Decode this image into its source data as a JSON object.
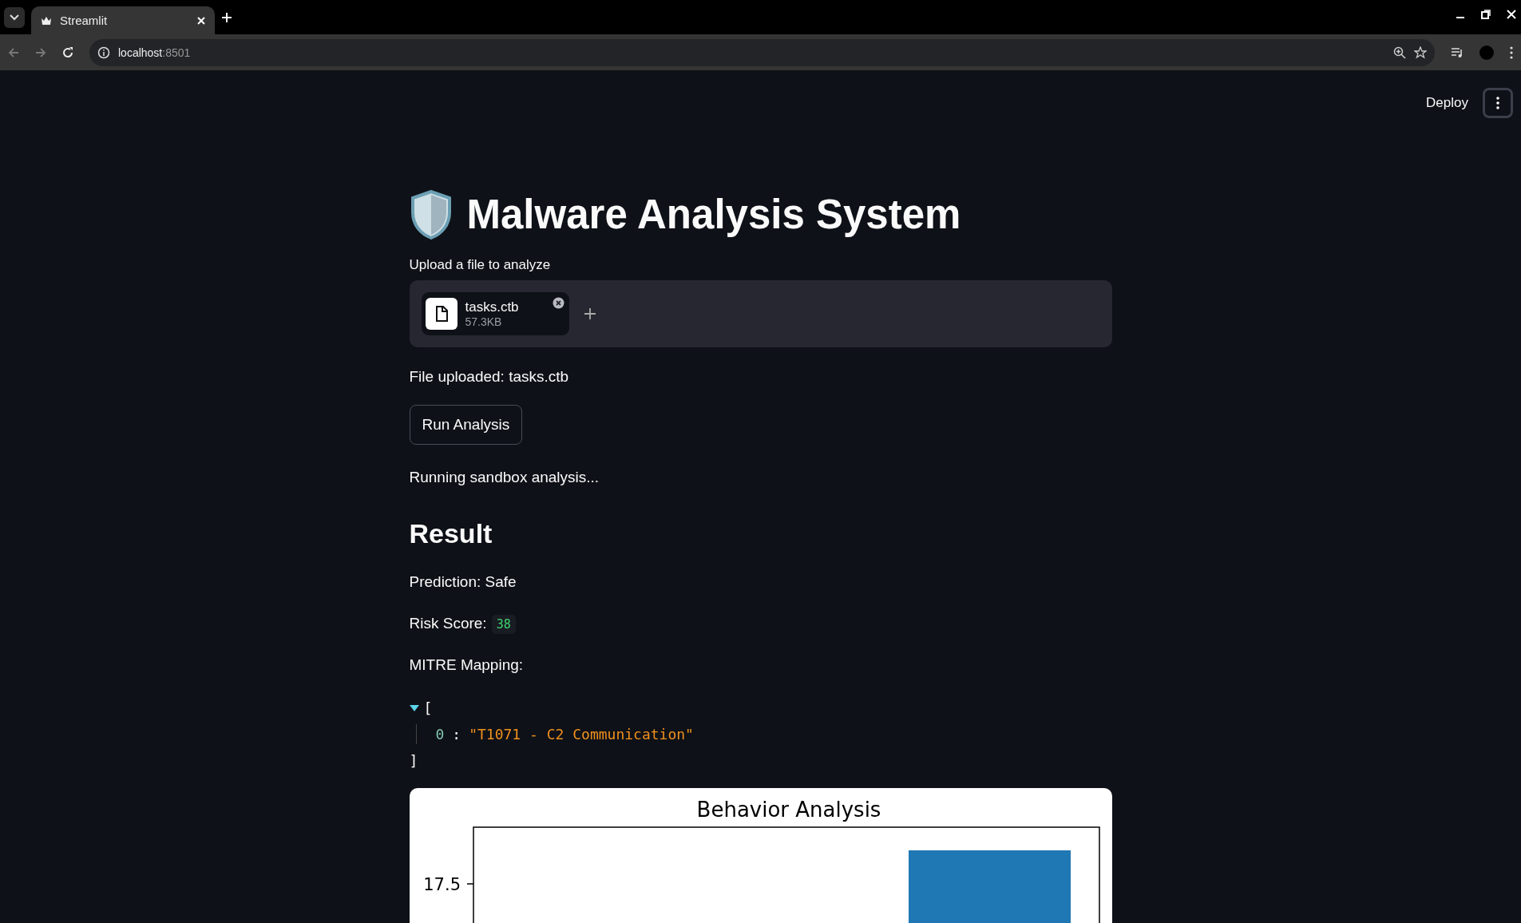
{
  "browser": {
    "tab_title": "Streamlit",
    "url_host": "localhost",
    "url_port": ":8501"
  },
  "header": {
    "deploy": "Deploy"
  },
  "title": "Malware Analysis System",
  "uploader": {
    "label": "Upload a file to analyze",
    "file_name": "tasks.ctb",
    "file_size": "57.3KB"
  },
  "uploaded_text": "File uploaded: tasks.ctb",
  "run_button": "Run Analysis",
  "status": "Running sandbox analysis...",
  "result_heading": "Result",
  "prediction": "Prediction: Safe",
  "risk": {
    "label": "Risk Score:",
    "value": "38"
  },
  "mitre_label": "MITRE Mapping:",
  "json_view": {
    "expanded": true,
    "open": "[",
    "close": "]",
    "entries": [
      {
        "index": "0",
        "separator": ":",
        "value": "\"T1071 - C2 Communication\""
      }
    ]
  },
  "chart": {
    "title": "Behavior Analysis",
    "ytick": "17.5"
  }
}
